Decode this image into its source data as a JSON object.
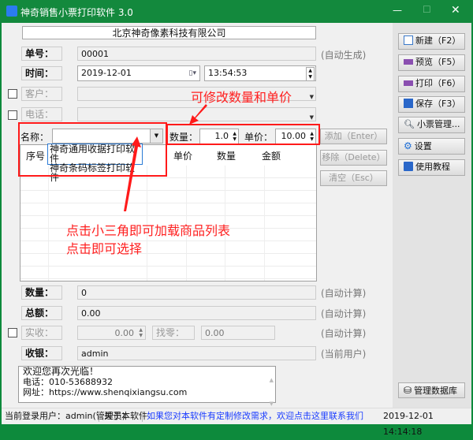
{
  "window": {
    "title": "神奇销售小票打印软件 3.0",
    "minimize": "—",
    "maximize": "☐",
    "close": "✕"
  },
  "company": "北京神奇像素科技有限公司",
  "form": {
    "order_no": {
      "label": "单号：",
      "value": "00001",
      "note": "(自动生成)"
    },
    "time": {
      "label": "时间：",
      "date": "2019-12-01",
      "time": "13:54:53"
    },
    "customer": {
      "label": "客户：",
      "value": "",
      "checked": false
    },
    "phone": {
      "label": "电话：",
      "value": "",
      "checked": false
    },
    "name": {
      "label": "名称：",
      "value": "",
      "options": [
        "神奇通用收据打印软件",
        "神奇条码标签打印软件"
      ]
    },
    "quantity": {
      "label": "数量：",
      "value": "1.0"
    },
    "unit_price": {
      "label": "单价：",
      "value": "10.00"
    }
  },
  "item_buttons": {
    "add": "添加（Enter）",
    "remove": "移除（Delete）",
    "clear": "清空（Esc）"
  },
  "table": {
    "columns": [
      "序号",
      "",
      "单价",
      "数量",
      "金额"
    ]
  },
  "summary": {
    "qty": {
      "label": "数量：",
      "value": "0",
      "note": "(自动计算)"
    },
    "total": {
      "label": "总额：",
      "value": "0.00",
      "note": "(自动计算)"
    },
    "received": {
      "label": "实收：",
      "value": "0.00",
      "checked": false
    },
    "change": {
      "label": "找零：",
      "value": "0.00",
      "note": "(自动计算)"
    },
    "cashier": {
      "label": "收银：",
      "value": "admin",
      "note": "(当前用户)"
    }
  },
  "footer_text": [
    "欢迎您再次光临！",
    "电话：010-53688932",
    "网址：https://www.shenqixiangsu.com"
  ],
  "side_buttons": [
    {
      "label": "新建（F2）",
      "icon": "new-document-icon"
    },
    {
      "label": "预览（F5）",
      "icon": "preview-printer-icon"
    },
    {
      "label": "打印（F6）",
      "icon": "printer-icon"
    },
    {
      "label": "保存（F3）",
      "icon": "save-icon"
    },
    {
      "label": "小票管理...",
      "icon": "search-icon"
    },
    {
      "label": "设置",
      "icon": "gear-icon"
    },
    {
      "label": "使用教程",
      "icon": "book-icon"
    }
  ],
  "db_button": "管理数据库",
  "annotations": {
    "top": "可修改数量和单价",
    "bottom1": "点击小三角即可加载商品列表",
    "bottom2": "点击即可选择",
    "color": "#ff2020"
  },
  "status": {
    "user": "当前登录用户：admin(管理员)",
    "about": "关于本软件",
    "contact": "如果您对本软件有定制修改需求，欢迎点击这里联系我们",
    "datetime": "2019-12-01 14:14:18"
  },
  "colors": {
    "titlebar": "#13893d",
    "link": "#1a3cff"
  }
}
